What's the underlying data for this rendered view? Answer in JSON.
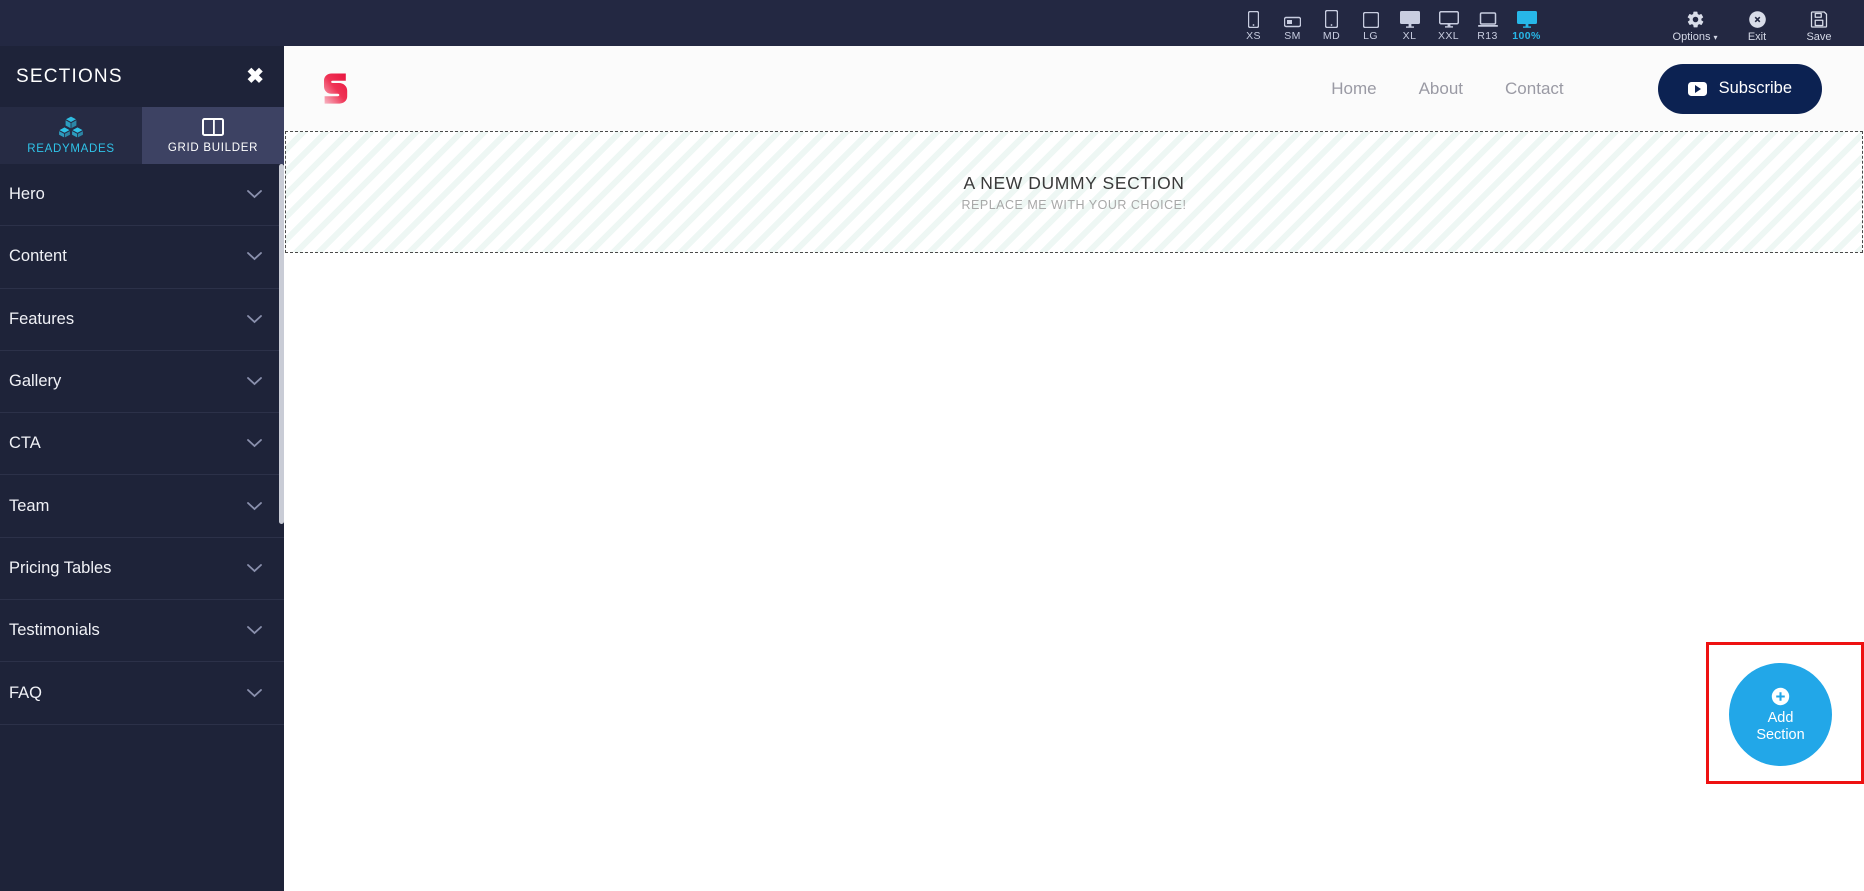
{
  "toolbar": {
    "devices": [
      {
        "label": "XS",
        "icon": "phone-portrait-icon",
        "active": false
      },
      {
        "label": "SM",
        "icon": "phone-landscape-icon",
        "active": false
      },
      {
        "label": "MD",
        "icon": "tablet-portrait-icon",
        "active": false
      },
      {
        "label": "LG",
        "icon": "tablet-landscape-icon",
        "active": false
      },
      {
        "label": "XL",
        "icon": "desktop-icon",
        "active": false
      },
      {
        "label": "XXL",
        "icon": "monitor-icon",
        "active": false
      },
      {
        "label": "R13",
        "icon": "laptop-icon",
        "active": false
      },
      {
        "label": "100%",
        "icon": "fullscreen-monitor-icon",
        "active": true
      }
    ],
    "actions": [
      {
        "label": "Options",
        "icon": "gear-icon",
        "caret": "▾"
      },
      {
        "label": "Exit",
        "icon": "close-circle-icon",
        "caret": ""
      },
      {
        "label": "Save",
        "icon": "floppy-disk-icon",
        "caret": ""
      }
    ]
  },
  "sidebar": {
    "title": "SECTIONS",
    "close_label": "✖",
    "tabs": [
      {
        "label": "READYMADES",
        "icon": "cubes-icon",
        "active": true
      },
      {
        "label": "GRID BUILDER",
        "icon": "columns-icon",
        "active": false
      }
    ],
    "items": [
      {
        "label": "Hero",
        "chevron": "chevron-down-icon"
      },
      {
        "label": "Content",
        "chevron": "chevron-down-icon"
      },
      {
        "label": "Features",
        "chevron": "chevron-down-icon"
      },
      {
        "label": "Gallery",
        "chevron": "chevron-down-icon"
      },
      {
        "label": "CTA",
        "chevron": "chevron-down-icon"
      },
      {
        "label": "Team",
        "chevron": "chevron-down-icon"
      },
      {
        "label": "Pricing Tables",
        "chevron": "chevron-down-icon"
      },
      {
        "label": "Testimonials",
        "chevron": "chevron-down-icon"
      },
      {
        "label": "FAQ",
        "chevron": "chevron-down-icon"
      }
    ]
  },
  "preview": {
    "logo_icon": "s-logo-icon",
    "nav": [
      {
        "label": "Home"
      },
      {
        "label": "About"
      },
      {
        "label": "Contact"
      }
    ],
    "subscribe_label": "Subscribe",
    "subscribe_icon": "youtube-play-icon",
    "dummy_section": {
      "title": "A NEW DUMMY SECTION",
      "subtitle": "REPLACE ME WITH YOUR CHOICE!"
    }
  },
  "add_section": {
    "line1": "Add",
    "line2": "Section",
    "icon": "plus-circle-icon"
  },
  "colors": {
    "toolbar_bg": "#232842",
    "sidebar_bg": "#1e2339",
    "tab_active_bg": "#262b44",
    "tab_inactive_bg": "#3d4263",
    "accent_cyan": "#2fc3e8",
    "add_button_blue": "#22a7e8",
    "subscribe_navy": "#0c2252",
    "annotation_red": "#ee1111",
    "logo_red": "#ef3355"
  }
}
